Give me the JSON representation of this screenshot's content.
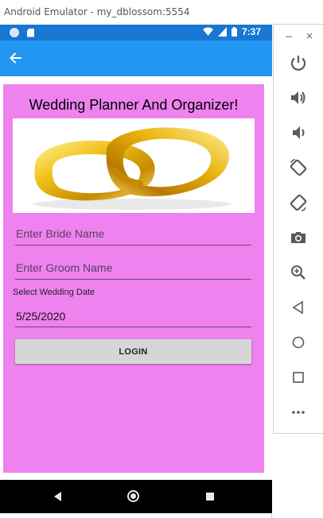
{
  "window": {
    "title": "Android Emulator - my_dblossom:5554"
  },
  "status_bar": {
    "time": "7:37",
    "color": "#1976d2"
  },
  "app_bar": {
    "color": "#2196f3",
    "back_icon": "arrow-left-icon"
  },
  "page": {
    "background": "#ee82ee",
    "title": "Wedding Planner And Organizer!",
    "image_icon": "wedding-rings-image",
    "bride_placeholder": "Enter Bride Name",
    "groom_placeholder": "Enter Groom Name",
    "date_label": "Select Wedding Date",
    "date_value": "5/25/2020",
    "login_label": "LOGIN"
  },
  "nav_bar": {
    "icons": [
      "back-triangle-icon",
      "home-circle-icon",
      "recents-square-icon"
    ]
  },
  "toolbar": {
    "minimize_label": "−",
    "close_label": "×",
    "buttons": [
      "power-icon",
      "volume-up-icon",
      "volume-down-icon",
      "rotate-left-icon",
      "rotate-right-icon",
      "camera-icon",
      "zoom-icon",
      "back-icon",
      "home-icon",
      "overview-icon",
      "more-icon"
    ]
  }
}
